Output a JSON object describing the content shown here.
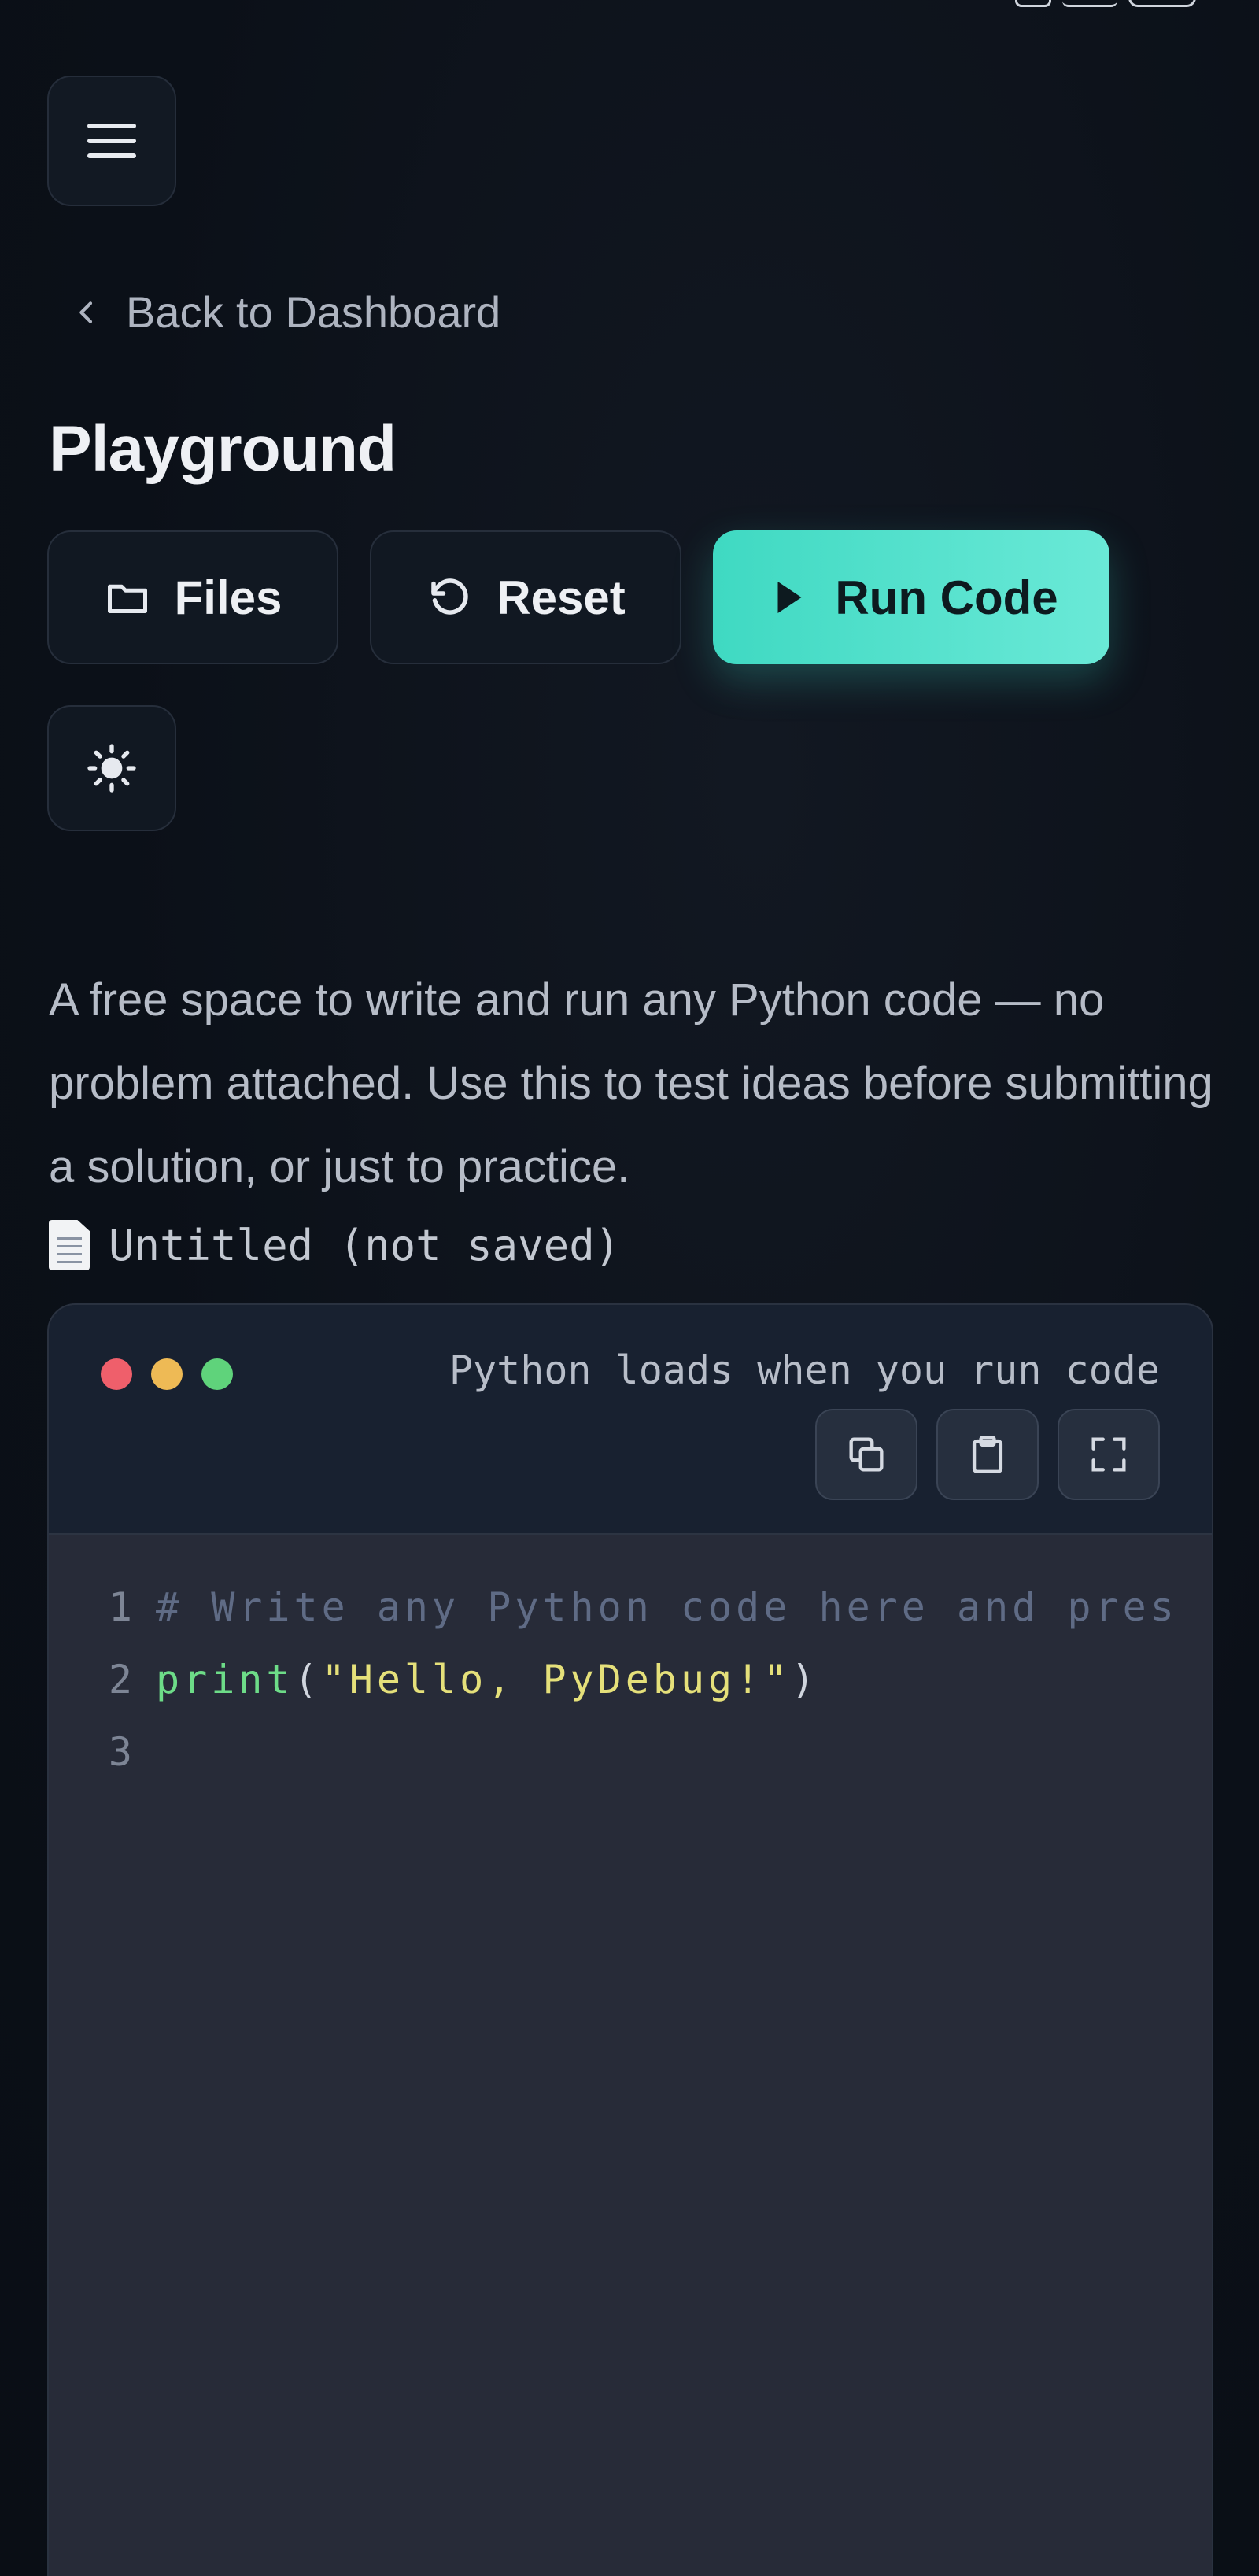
{
  "header": {
    "back_label": "Back to Dashboard",
    "title": "Playground"
  },
  "toolbar": {
    "files_label": "Files",
    "reset_label": "Reset",
    "run_label": "Run Code"
  },
  "description": "A free space to write and run any Python code — no problem attached. Use this to test ideas before submitting a solution, or just to practice.",
  "file": {
    "name": "Untitled (not saved)"
  },
  "editor": {
    "note": "Python loads when you run code",
    "lines": [
      {
        "number": "1",
        "comment": "# Write any Python code here and pres"
      },
      {
        "number": "2",
        "fn": "print",
        "open": "(",
        "string": "\"Hello, PyDebug!\"",
        "close": ")"
      },
      {
        "number": "3"
      }
    ]
  },
  "icons": {
    "menu": "hamburger-menu-icon",
    "back": "chevron-left-icon",
    "files": "folder-icon",
    "reset": "rotate-ccw-icon",
    "run": "play-icon",
    "theme": "sun-icon",
    "file": "document-icon",
    "copy": "copy-icon",
    "paste": "clipboard-icon",
    "fullscreen": "fullscreen-icon"
  },
  "colors": {
    "accent": "#4fe0ca",
    "background": "#0c111a",
    "editor_bg": "#272b38",
    "dot_red": "#ef5f6b",
    "dot_yellow": "#eeba55",
    "dot_green": "#5fd37b"
  }
}
